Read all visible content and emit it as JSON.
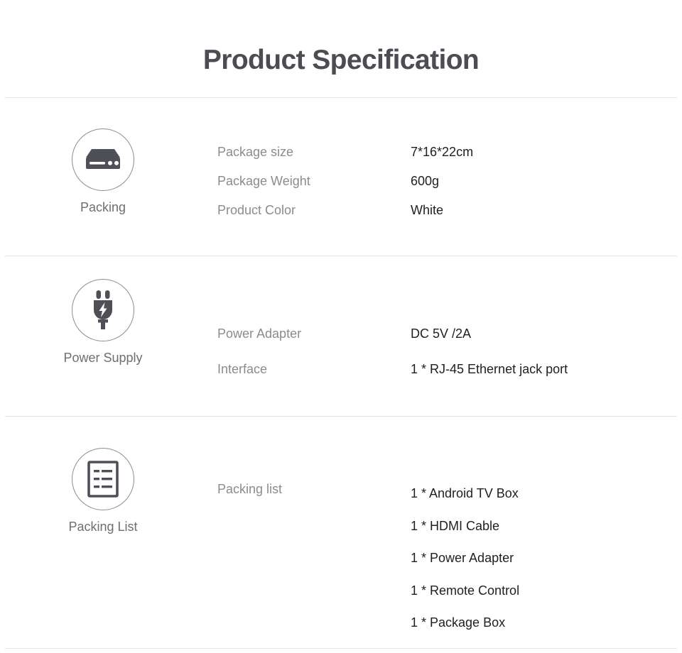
{
  "header": {
    "title": "Product Specification"
  },
  "colors": {
    "title": "#4c4c52",
    "label": "#8b8b91",
    "value": "#1f1f1f",
    "caption": "#6e6e74",
    "icon": "#4f4f58",
    "divider": "#e2e2e2",
    "background": "#ffffff"
  },
  "sections": [
    {
      "id": "packing",
      "icon": "set-top-box-icon",
      "caption": "Packing",
      "specs": [
        {
          "label": "Package size",
          "value": "7*16*22cm"
        },
        {
          "label": "Package Weight",
          "value": "600g"
        },
        {
          "label": "Product Color",
          "value": "White"
        }
      ]
    },
    {
      "id": "power-supply",
      "icon": "power-plug-icon",
      "caption": "Power Supply",
      "specs": [
        {
          "label": "Power Adapter",
          "value": "DC 5V /2A"
        },
        {
          "label": "Interface",
          "value": "1 * RJ-45 Ethernet jack port"
        }
      ]
    },
    {
      "id": "packing-list",
      "icon": "document-list-icon",
      "caption": "Packing List",
      "specs": [
        {
          "label": "Packing list",
          "value": ""
        }
      ],
      "items": [
        "1 * Android TV Box",
        "1 * HDMI Cable",
        "1 * Power Adapter",
        "1 * Remote Control",
        "1 * Package Box"
      ]
    }
  ]
}
